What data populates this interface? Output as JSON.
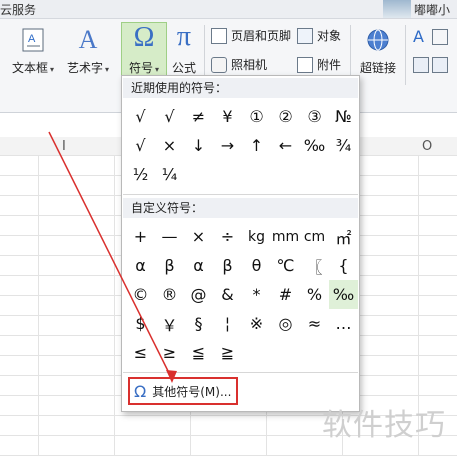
{
  "topbar": {
    "service_label": "云服务",
    "user_name": "嘟嘟小"
  },
  "ribbon": {
    "textbox_label": "文本框",
    "wordart_label": "艺术字",
    "symbol_label": "符号",
    "formula_label": "公式",
    "header_footer_label": "页眉和页脚",
    "camera_label": "照相机",
    "object_label": "对象",
    "attachment_label": "附件",
    "hyperlink_label": "超链接",
    "dropdown_arrow": "▾",
    "omega_glyph": "Ω",
    "pi_glyph": "π",
    "A_glyph": "A"
  },
  "sheet": {
    "col_I": "I",
    "col_O": "O"
  },
  "symbols_panel": {
    "recent_header": "近期使用的符号：",
    "recent": [
      "√",
      "√",
      "≠",
      "¥",
      "①",
      "②",
      "③",
      "№",
      "√",
      "×",
      "↓",
      "→",
      "↑",
      "←",
      "‰",
      "¾",
      "½",
      "¼"
    ],
    "custom_header": "自定义符号：",
    "custom": [
      "+",
      "—",
      "×",
      "÷",
      "kg",
      "mm",
      "cm",
      "㎡",
      "α",
      "β",
      "α",
      "β",
      "θ",
      "℃",
      "〖",
      "{",
      "©",
      "®",
      "@",
      "&",
      "*",
      "#",
      "%",
      "‰",
      "$",
      "￥",
      "§",
      "¦",
      "※",
      "◎",
      "≈",
      "…",
      "≤",
      "≥",
      "≦",
      "≧"
    ],
    "highlighted_custom": "‰",
    "more_label": "其他符号(M)...",
    "more_icon": "Ω"
  },
  "watermark": "软件技巧",
  "colors": {
    "accent_green": "#dff0d8",
    "highlight_box": "#d9302e",
    "arrow_red": "#d9302e",
    "ribbon_bg": "#f5f6f8"
  }
}
